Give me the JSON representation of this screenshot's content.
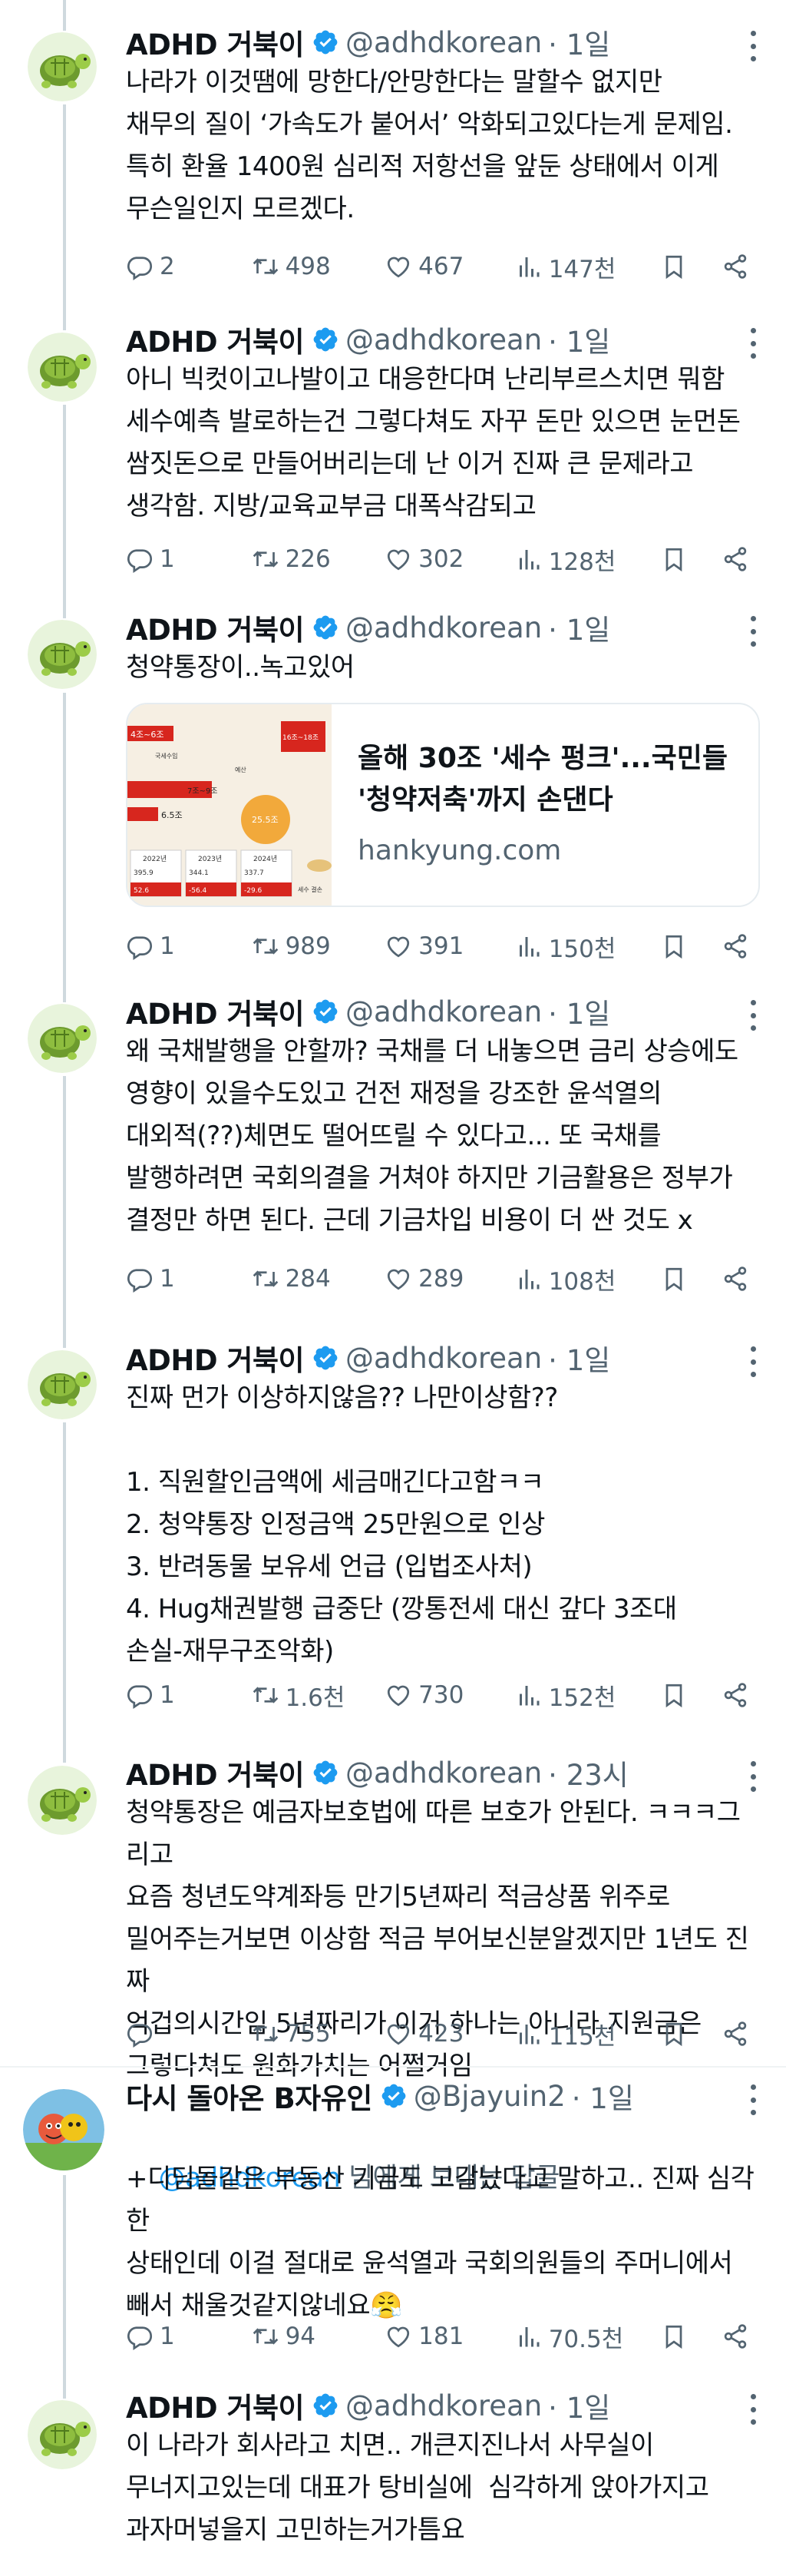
{
  "tweets": [
    {
      "name": "ADHD 거북이",
      "handle": "@adhdkorean",
      "time": "· 1일",
      "text": "나라가 이것땜에 망한다/안망한다는 말할수 없지만\n채무의 질이 ‘가속도가 붙어서’ 악화되고있다는게 문제임.\n특히 환율 1400원 심리적 저항선을 앞둔 상태에서 이게\n무슨일인지 모르겠다.",
      "replies": "2",
      "reposts": "498",
      "likes": "467",
      "views": "147천"
    },
    {
      "name": "ADHD 거북이",
      "handle": "@adhdkorean",
      "time": "· 1일",
      "text": "아니 빅컷이고나발이고 대응한다며 난리부르스치면 뭐함\n세수예측 발로하는건 그렇다쳐도 자꾸 돈만 있으면 눈먼돈\n쌈짓돈으로 만들어버리는데 난 이거 진짜 큰 문제라고\n생각함. 지방/교육교부금 대폭삭감되고",
      "replies": "1",
      "reposts": "226",
      "likes": "302",
      "views": "128천"
    },
    {
      "name": "ADHD 거북이",
      "handle": "@adhdkorean",
      "time": "· 1일",
      "text": "청약통장이..녹고있어",
      "card_title": "올해 30조 '세수 펑크'...국민들 '청약저축'까지 손댄다",
      "card_domain": "hankyung.com",
      "replies": "1",
      "reposts": "989",
      "likes": "391",
      "views": "150천"
    },
    {
      "name": "ADHD 거북이",
      "handle": "@adhdkorean",
      "time": "· 1일",
      "text": "왜 국채발행을 안할까? 국채를 더 내놓으면 금리 상승에도\n영향이 있을수도있고 건전 재정을 강조한 윤석열의\n대외적(??)체면도 떨어뜨릴 수 있다고... 또 국채를\n발행하려면 국회의결을 거쳐야 하지만 기금활용은 정부가\n결정만 하면 된다. 근데 기금차입 비용이 더 싼 것도 x",
      "replies": "1",
      "reposts": "284",
      "likes": "289",
      "views": "108천"
    },
    {
      "name": "ADHD 거북이",
      "handle": "@adhdkorean",
      "time": "· 1일",
      "text": "진짜 먼가 이상하지않음?? 나만이상함??\n\n1. 직원할인금액에 세금매긴다고함ㅋㅋ\n2. 청약통장 인정금액 25만원으로 인상\n3. 반려동물 보유세 언급 (입법조사처)\n4. Hug채권발행 급중단 (깡통전세 대신 갚다 3조대\n손실-재무구조악화)",
      "replies": "1",
      "reposts": "1.6천",
      "likes": "730",
      "views": "152천"
    },
    {
      "name": "ADHD 거북이",
      "handle": "@adhdkorean",
      "time": "· 23시",
      "text": "청약통장은 예금자보호법에 따른 보호가 안된다. ㅋㅋㅋ그리고\n요즘 청년도약계좌등 만기5년짜리 적금상품 위주로\n밀어주는거보면 이상함 적금 부어보신분알겠지만 1년도 진짜\n억겁의시간임 5년짜리가 이거 하나는 아니라 지원금은\n그렇다쳐도 원화가치는 어쩔거임",
      "replies": "",
      "reposts": "755",
      "likes": "423",
      "views": "115천"
    },
    {
      "name": "다시 돌아온 B자유인",
      "handle": "@Bjayuin2",
      "time": "· 1일",
      "reply_to_mention": "@adhdkorean",
      "reply_to_suffix": " 님에게 보내는 답글",
      "text": "+디딤돌같은 부동산 기금도 고갈났다고 말하고.. 진짜 심각한\n상태인데 이걸 절대로 윤석열과 국회의원들의 주머니에서\n빼서 채울것같지않네요😤",
      "replies": "1",
      "reposts": "94",
      "likes": "181",
      "views": "70.5천"
    },
    {
      "name": "ADHD 거북이",
      "handle": "@adhdkorean",
      "time": "· 1일",
      "text": "이 나라가 회사라고 치면.. 개큰지진나서 사무실이\n무너지고있는데 대표가 탕비실에  심각하게 앉아가지고\n과자머넣을지 고민하는거가틈요"
    }
  ],
  "card_thumb": {
    "labels": [
      "4조~6조",
      "7조~9조",
      "6.5조",
      "16조~18조",
      "2022년",
      "2023년",
      "2024년",
      "국세수입",
      "예산",
      "세수 결손"
    ],
    "values": [
      "395.9",
      "344.1",
      "337.7",
      "52.6",
      "-56.4",
      "-29.6"
    ],
    "badge": "25.5조"
  },
  "colors": {
    "accent": "#1d9bf0",
    "muted": "#536471",
    "red": "#d7261e"
  }
}
